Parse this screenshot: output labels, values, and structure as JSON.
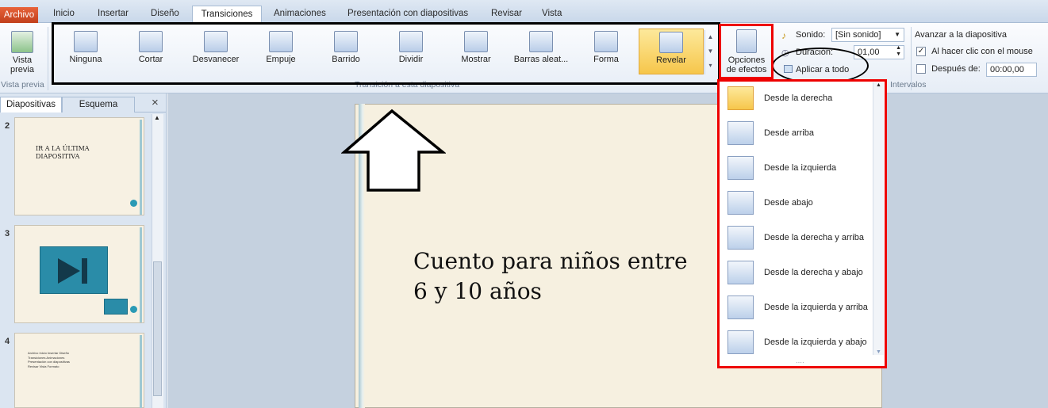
{
  "tabs": {
    "file": "Archivo",
    "items": [
      "Inicio",
      "Insertar",
      "Diseño",
      "Transiciones",
      "Animaciones",
      "Presentación con diapositivas",
      "Revisar",
      "Vista"
    ]
  },
  "ribbon": {
    "preview_label_1": "Vista",
    "preview_label_2": "previa",
    "preview_group": "Vista previa",
    "transitions_group": "Transición a esta diapositiva",
    "transitions": [
      "Ninguna",
      "Cortar",
      "Desvanecer",
      "Empuje",
      "Barrido",
      "Dividir",
      "Mostrar",
      "Barras aleat...",
      "Forma",
      "Revelar"
    ],
    "effect_options_1": "Opciones",
    "effect_options_2": "de efectos",
    "sound_label": "Sonido:",
    "sound_value": "[Sin sonido]",
    "duration_label": "Duración:",
    "duration_value": "01,00",
    "apply_all": "Aplicar a todo",
    "advance_title": "Avanzar a la diapositiva",
    "on_click": "Al hacer clic con el mouse",
    "after_label": "Después de:",
    "after_value": "00:00,00",
    "timing_group": "Intervalos"
  },
  "panel": {
    "tab_slides": "Diapositivas",
    "tab_outline": "Esquema",
    "close": "×",
    "thumbs": [
      {
        "num": "2",
        "text": "IR A LA ÚLTIMA DIAPOSITIVA"
      },
      {
        "num": "3",
        "text": ""
      },
      {
        "num": "4",
        "text": "Archivo Inicio Insertar Diseño Transiciones Animaciones Presentación con diapositivas Revisar Vista Formato"
      }
    ]
  },
  "slide": {
    "title_line1": "Cuento para niños entre",
    "title_line2": "6 y 10 años"
  },
  "effects_menu": [
    "Desde la derecha",
    "Desde arriba",
    "Desde la izquierda",
    "Desde abajo",
    "Desde la derecha y arriba",
    "Desde la derecha y abajo",
    "Desde la izquierda y arriba",
    "Desde la izquierda y abajo"
  ],
  "colors": {
    "annotation_red": "#e00000",
    "annotation_black": "#000000",
    "file_tab": "#d5502a",
    "selected": "#f6c64b"
  }
}
